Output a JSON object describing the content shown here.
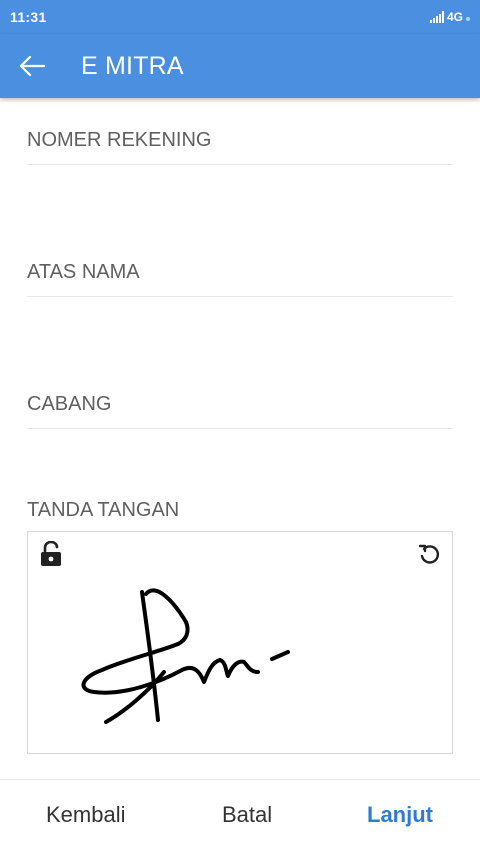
{
  "status_bar": {
    "time": "11:31",
    "network": "4G"
  },
  "app_bar": {
    "title": "E MITRA"
  },
  "form": {
    "account_number_label": "NOMER REKENING",
    "account_name_label": "ATAS NAMA",
    "branch_label": "CABANG",
    "signature_label": "TANDA TANGAN"
  },
  "buttons": {
    "back": "Kembali",
    "cancel": "Batal",
    "next": "Lanjut"
  },
  "colors": {
    "primary": "#4a8fe0",
    "accent": "#2f7bd4"
  }
}
